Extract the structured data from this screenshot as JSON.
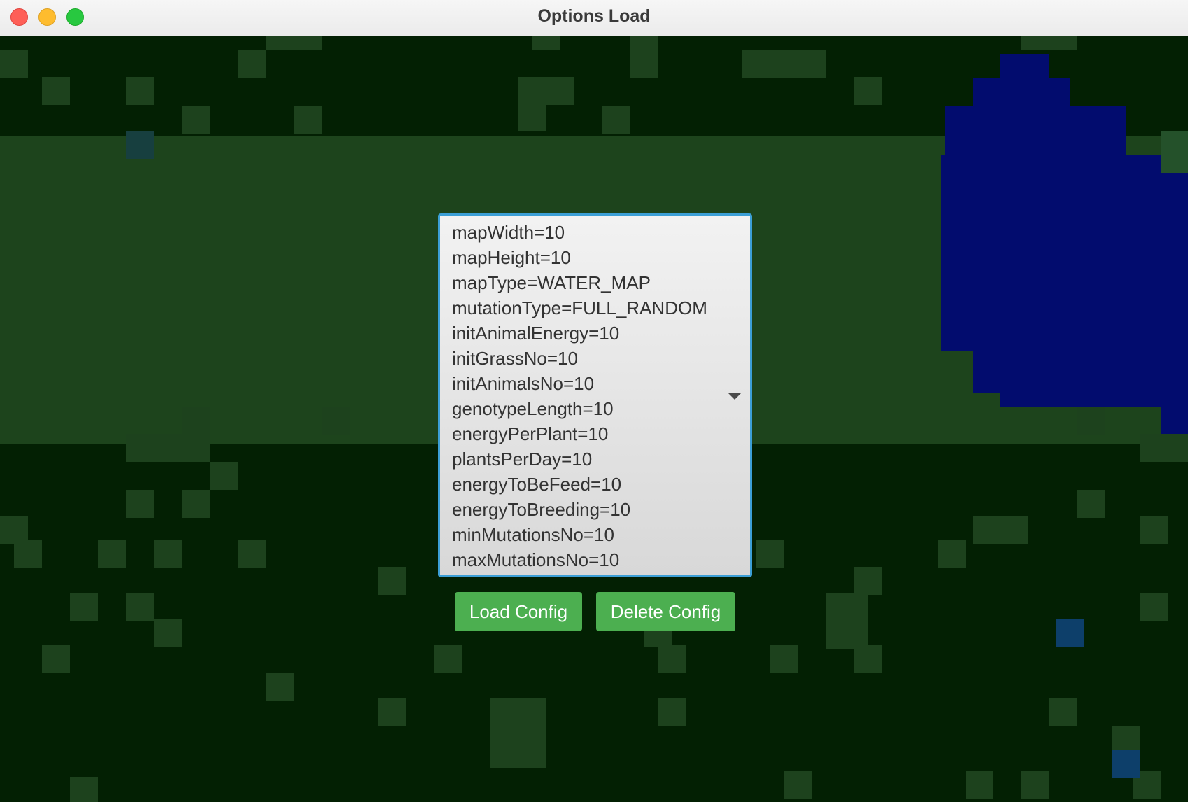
{
  "window": {
    "title": "Options Load"
  },
  "config": {
    "lines": [
      "mapWidth=10",
      "mapHeight=10",
      "mapType=WATER_MAP",
      "mutationType=FULL_RANDOM",
      "initAnimalEnergy=10",
      "initGrassNo=10",
      "initAnimalsNo=10",
      "genotypeLength=10",
      "energyPerPlant=10",
      "plantsPerDay=10",
      "energyToBeFeed=10",
      "energyToBreeding=10",
      "minMutationsNo=10",
      "maxMutationsNo=10"
    ]
  },
  "buttons": {
    "load_label": "Load Config",
    "delete_label": "Delete Config"
  },
  "colors": {
    "accent_button": "#4caf50",
    "focus_border": "#3c9fd6",
    "background_dark": "#032003",
    "band_green": "#1d441c",
    "water": "#020c6e"
  }
}
